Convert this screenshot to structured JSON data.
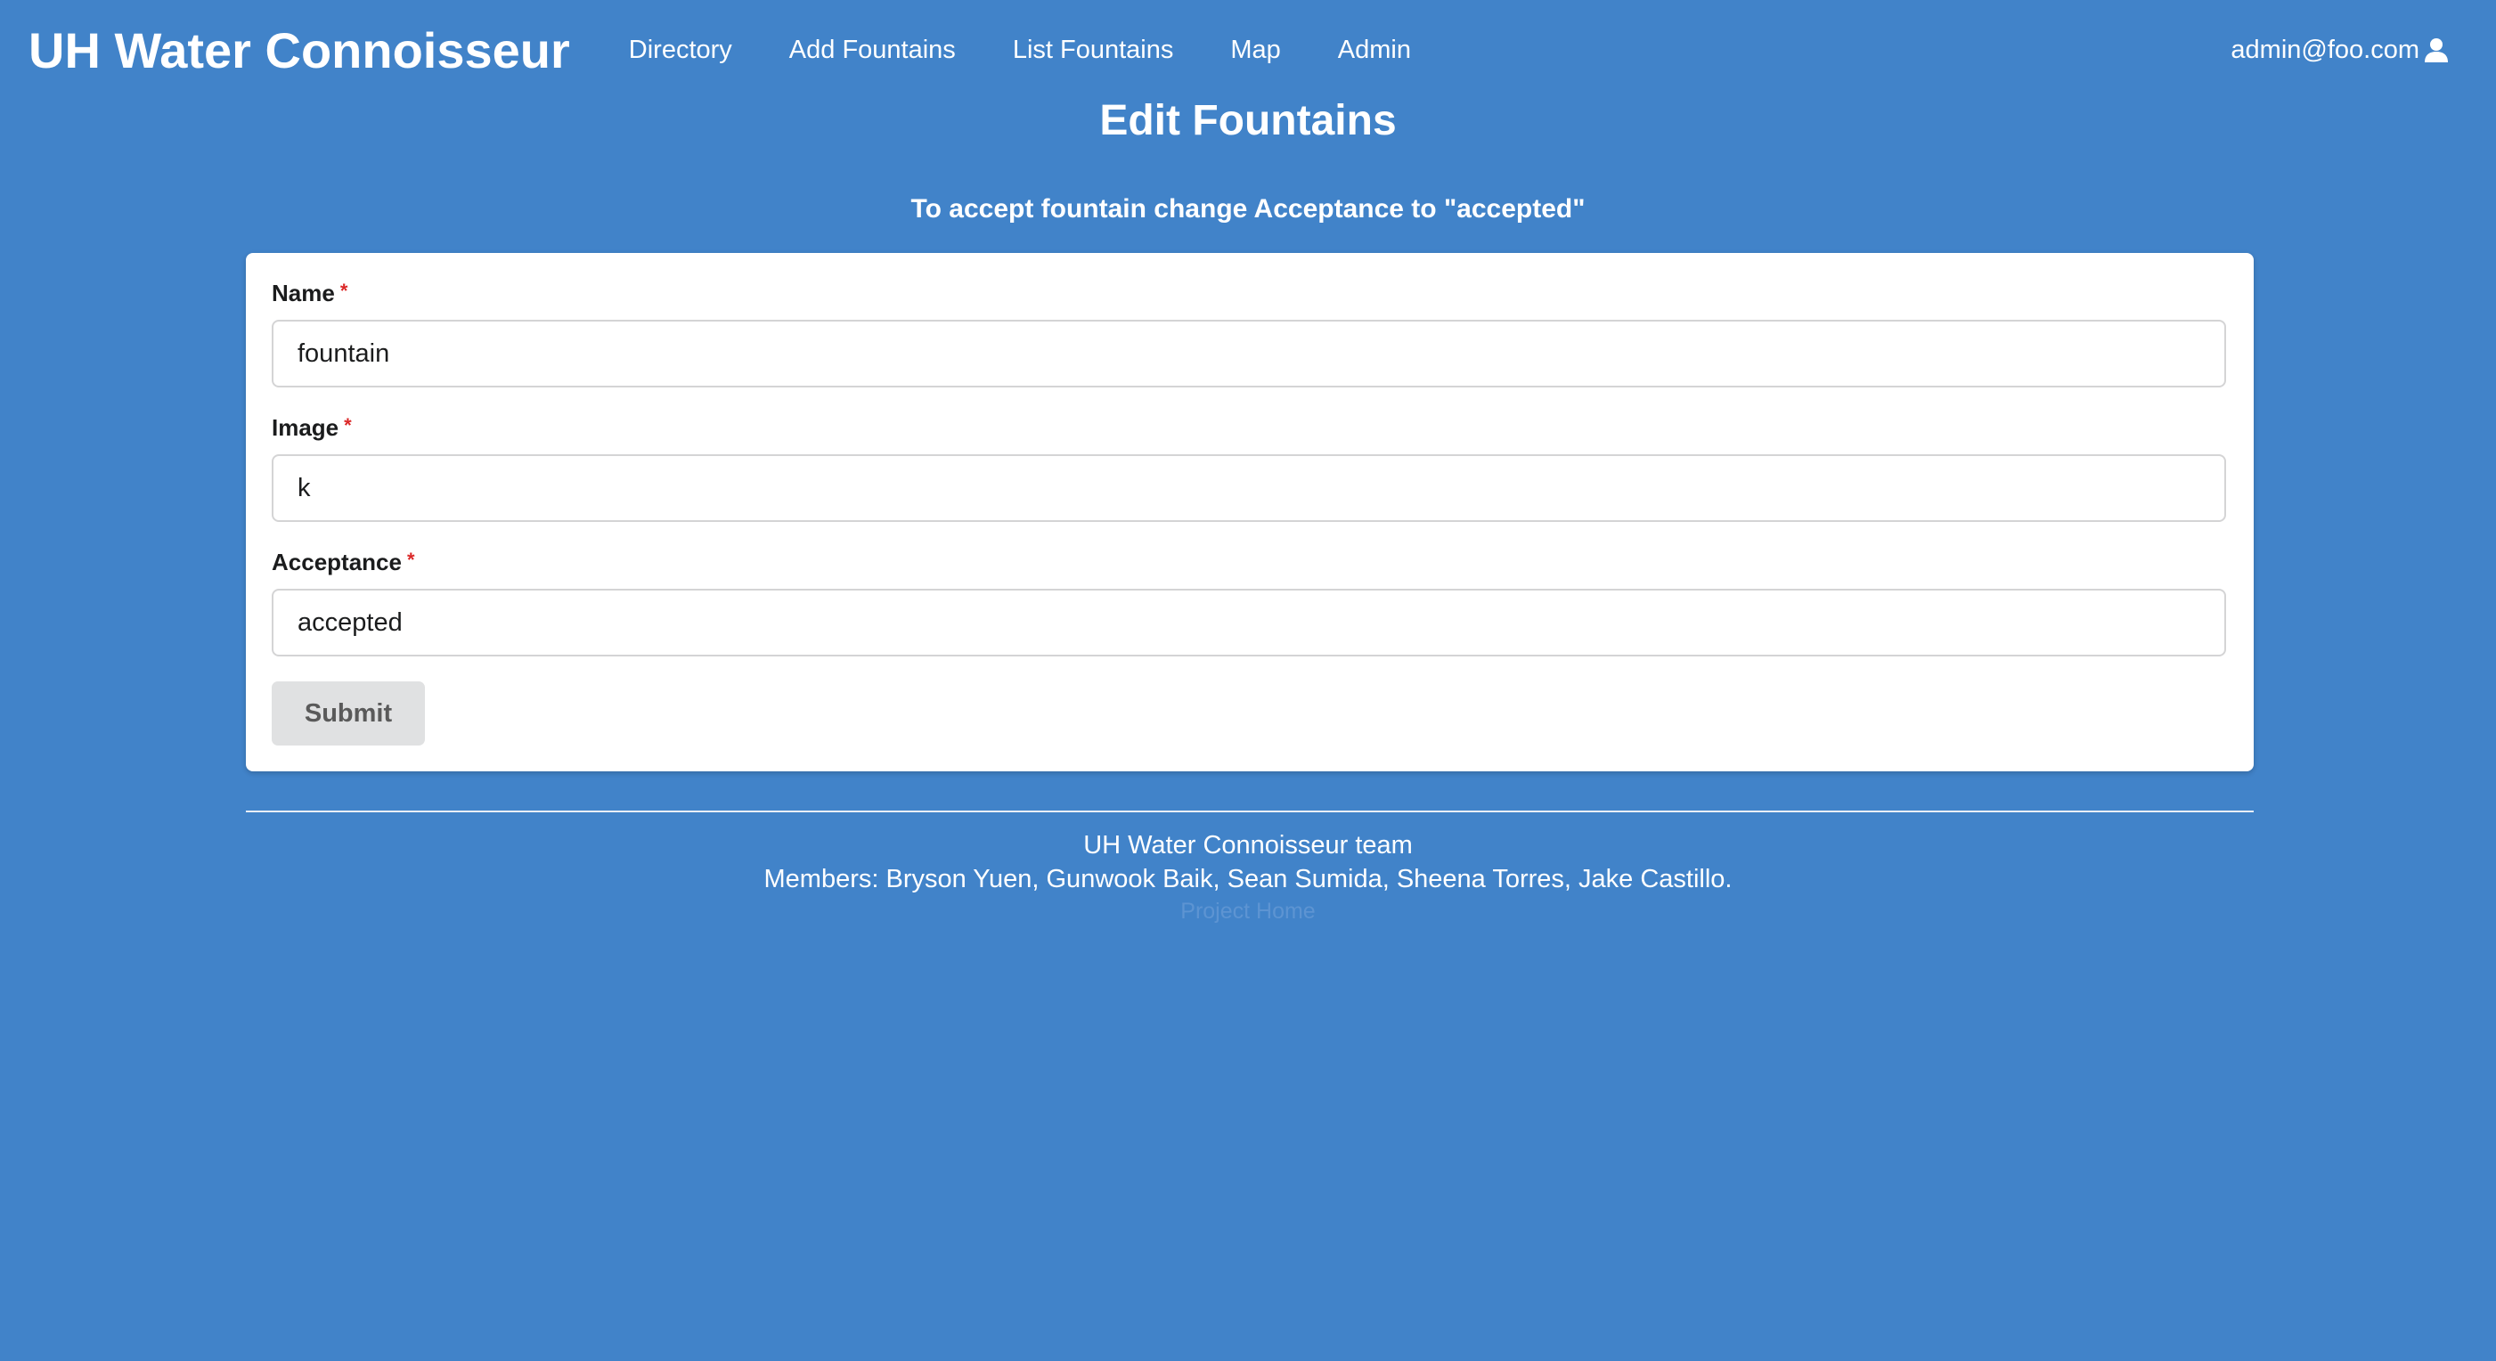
{
  "navbar": {
    "brand": "UH Water Connoisseur",
    "items": [
      {
        "label": "Directory"
      },
      {
        "label": "Add Fountains"
      },
      {
        "label": "List Fountains"
      },
      {
        "label": "Map"
      },
      {
        "label": "Admin"
      }
    ],
    "user_email": "admin@foo.com",
    "user_icon": "user-icon"
  },
  "page": {
    "title": "Edit Fountains",
    "instruction": "To accept fountain change Acceptance to \"accepted\""
  },
  "form": {
    "name": {
      "label": "Name",
      "required_marker": "*",
      "value": "fountain"
    },
    "image": {
      "label": "Image",
      "required_marker": "*",
      "value": "k"
    },
    "acceptance": {
      "label": "Acceptance",
      "required_marker": "*",
      "value": "accepted"
    },
    "submit_label": "Submit"
  },
  "footer": {
    "team": "UH Water Connoisseur team",
    "members": "Members: Bryson Yuen, Gunwook Baik, Sean Sumida, Sheena Torres, Jake Castillo.",
    "link": "Project Home"
  },
  "colors": {
    "background": "#4183c9",
    "card": "#ffffff",
    "required": "#db2828",
    "button": "#e0e1e2"
  }
}
